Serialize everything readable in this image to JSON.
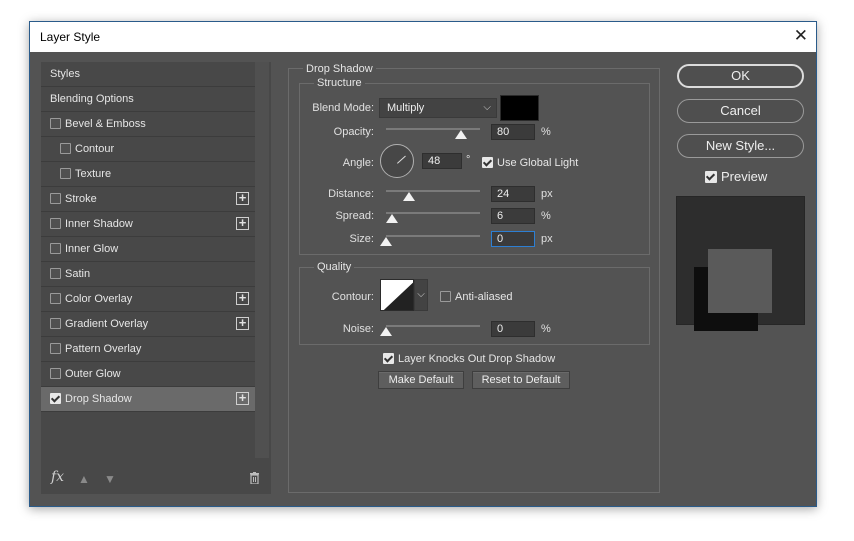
{
  "window": {
    "title": "Layer Style",
    "close_glyph": "✕"
  },
  "styles_list": [
    {
      "label": "Styles",
      "checkbox": false,
      "checked": false,
      "plus": false,
      "sub": false,
      "selected": false
    },
    {
      "label": "Blending Options",
      "checkbox": false,
      "checked": false,
      "plus": false,
      "sub": false,
      "selected": false
    },
    {
      "label": "Bevel & Emboss",
      "checkbox": true,
      "checked": false,
      "plus": false,
      "sub": false,
      "selected": false
    },
    {
      "label": "Contour",
      "checkbox": true,
      "checked": false,
      "plus": false,
      "sub": true,
      "selected": false
    },
    {
      "label": "Texture",
      "checkbox": true,
      "checked": false,
      "plus": false,
      "sub": true,
      "selected": false
    },
    {
      "label": "Stroke",
      "checkbox": true,
      "checked": false,
      "plus": true,
      "sub": false,
      "selected": false
    },
    {
      "label": "Inner Shadow",
      "checkbox": true,
      "checked": false,
      "plus": true,
      "sub": false,
      "selected": false
    },
    {
      "label": "Inner Glow",
      "checkbox": true,
      "checked": false,
      "plus": false,
      "sub": false,
      "selected": false
    },
    {
      "label": "Satin",
      "checkbox": true,
      "checked": false,
      "plus": false,
      "sub": false,
      "selected": false
    },
    {
      "label": "Color Overlay",
      "checkbox": true,
      "checked": false,
      "plus": true,
      "sub": false,
      "selected": false
    },
    {
      "label": "Gradient Overlay",
      "checkbox": true,
      "checked": false,
      "plus": true,
      "sub": false,
      "selected": false
    },
    {
      "label": "Pattern Overlay",
      "checkbox": true,
      "checked": false,
      "plus": false,
      "sub": false,
      "selected": false
    },
    {
      "label": "Outer Glow",
      "checkbox": true,
      "checked": false,
      "plus": false,
      "sub": false,
      "selected": false
    },
    {
      "label": "Drop Shadow",
      "checkbox": true,
      "checked": true,
      "plus": true,
      "sub": false,
      "selected": true
    }
  ],
  "footer": {
    "fx_label": "fx"
  },
  "drop_shadow": {
    "section_title": "Drop Shadow",
    "structure": {
      "legend": "Structure",
      "blend_mode_label": "Blend Mode:",
      "blend_mode_value": "Multiply",
      "shadow_color": "#000000",
      "opacity_label": "Opacity:",
      "opacity_value": "80",
      "opacity_unit": "%",
      "opacity_fraction": 0.8,
      "angle_label": "Angle:",
      "angle_value": "48",
      "angle_unit": "°",
      "use_global_light_label": "Use Global Light",
      "use_global_light": true,
      "distance_label": "Distance:",
      "distance_value": "24",
      "distance_unit": "px",
      "distance_fraction": 0.24,
      "spread_label": "Spread:",
      "spread_value": "6",
      "spread_unit": "%",
      "spread_fraction": 0.06,
      "size_label": "Size:",
      "size_value": "0",
      "size_unit": "px",
      "size_fraction": 0.0
    },
    "quality": {
      "legend": "Quality",
      "contour_label": "Contour:",
      "anti_aliased_label": "Anti-aliased",
      "anti_aliased": false,
      "noise_label": "Noise:",
      "noise_value": "0",
      "noise_unit": "%",
      "noise_fraction": 0.0
    },
    "knocks_out_label": "Layer Knocks Out Drop Shadow",
    "knocks_out": true,
    "make_default_label": "Make Default",
    "reset_default_label": "Reset to Default"
  },
  "right_panel": {
    "ok_label": "OK",
    "cancel_label": "Cancel",
    "new_style_label": "New Style...",
    "preview_label": "Preview",
    "preview_checked": true
  }
}
